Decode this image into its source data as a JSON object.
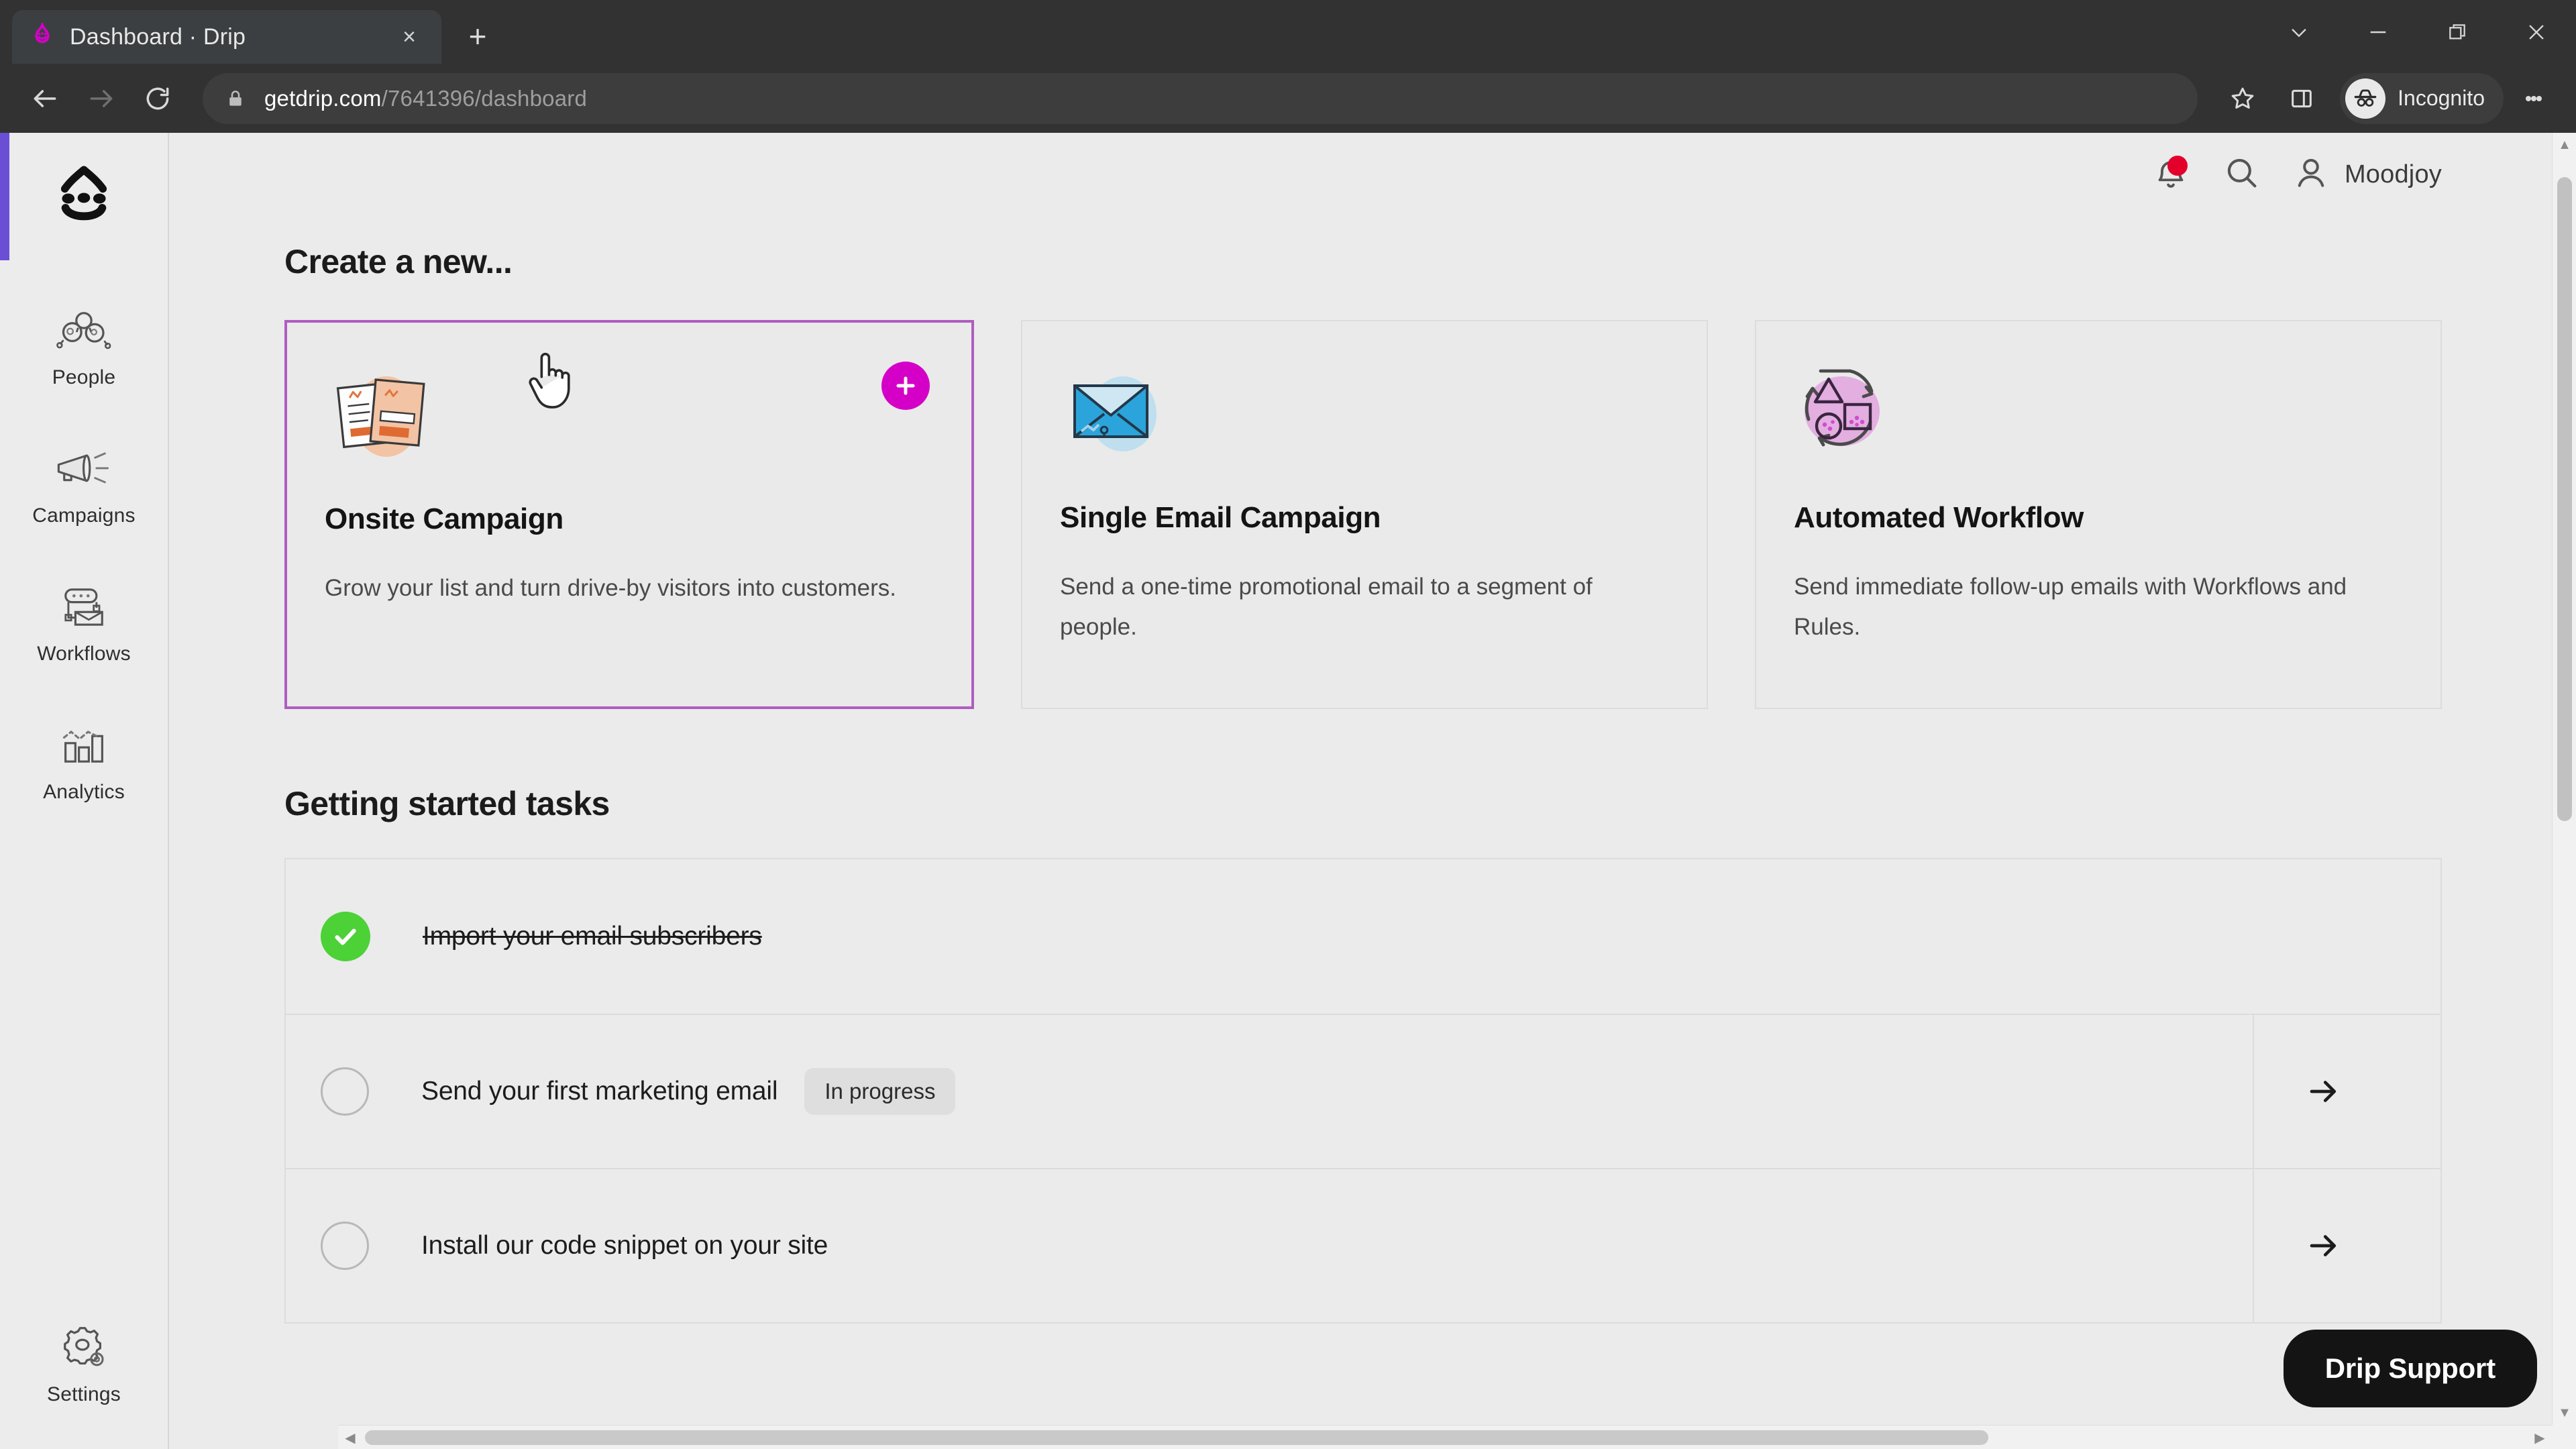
{
  "browser": {
    "tab": {
      "title": "Dashboard · Drip",
      "favicon": "drip-logo-icon",
      "close": "×"
    },
    "new_tab_label": "+",
    "window_controls": {
      "tab_search": "tab-search-chevron",
      "minimize": "–",
      "restore": "restore",
      "close": "✕"
    },
    "toolbar": {
      "back": "back-arrow",
      "forward": "forward-arrow",
      "reload": "reload-arrow",
      "url_host": "getdrip.com",
      "url_path": "/7641396/dashboard",
      "lock": "lock-icon",
      "bookmark": "star-icon",
      "side_panel": "side-panel-icon",
      "profile_label": "Incognito",
      "menu": "three-dot-menu"
    }
  },
  "sidebar": {
    "brand": "Drip",
    "items": [
      {
        "label": "People",
        "icon": "people-icon"
      },
      {
        "label": "Campaigns",
        "icon": "megaphone-icon"
      },
      {
        "label": "Workflows",
        "icon": "workflow-icon"
      },
      {
        "label": "Analytics",
        "icon": "bar-chart-icon"
      }
    ],
    "footer": {
      "label": "Settings",
      "icon": "gear-icon"
    },
    "accent_color": "#6a4fd6"
  },
  "app_header": {
    "notifications_icon": "bell-icon",
    "notification_dot_color": "#e3002b",
    "search_icon": "search-icon",
    "account_icon": "user-icon",
    "account_name": "Moodjoy"
  },
  "main": {
    "create_section": {
      "title": "Create a new...",
      "cards": [
        {
          "title": "Onsite Campaign",
          "desc": "Grow your list and turn drive-by visitors into customers.",
          "icon": "onsite-campaign-illustration",
          "active": true,
          "badge": "+",
          "badge_color": "#d500c8",
          "border_color": "#b05dc0"
        },
        {
          "title": "Single Email Campaign",
          "desc": "Send a one-time promotional email to a segment of people.",
          "icon": "envelope-illustration",
          "active": false
        },
        {
          "title": "Automated Workflow",
          "desc": "Send immediate follow-up emails with Workflows and Rules.",
          "icon": "shapes-cycle-illustration",
          "active": false
        }
      ]
    },
    "tasks_section": {
      "title": "Getting started tasks",
      "tasks": [
        {
          "label": "Import your email subscribers",
          "state": "done",
          "badge": "",
          "arrow": ""
        },
        {
          "label": "Send your first marketing email",
          "state": "todo",
          "badge": "In progress",
          "arrow": "→"
        },
        {
          "label": "Install our code snippet on your site",
          "state": "todo",
          "badge": "",
          "arrow": "→"
        }
      ]
    }
  },
  "support": {
    "label": "Drip Support"
  },
  "scrollbars": {
    "up": "▲",
    "down": "▼",
    "left": "◀",
    "right": "▶"
  }
}
